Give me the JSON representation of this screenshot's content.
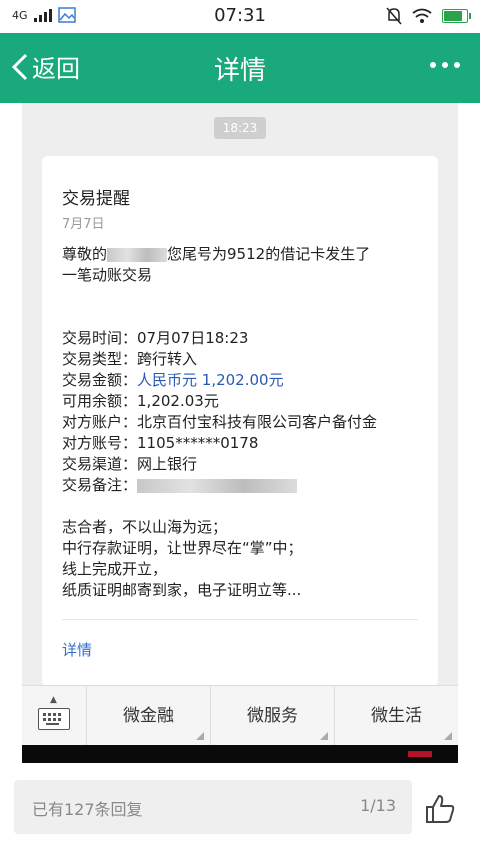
{
  "status_bar": {
    "network": "4G",
    "time": "07:31"
  },
  "nav": {
    "back_label": "返回",
    "title": "详情"
  },
  "chat": {
    "time_chip": "18:23",
    "card": {
      "title": "交易提醒",
      "date": "7月7日",
      "intro_prefix": "尊敬的",
      "intro_suffix": "您尾号为9512的借记卡发生了",
      "intro_line2": "一笔动账交易",
      "fields": [
        {
          "label": "交易时间：",
          "value": "07月07日18:23"
        },
        {
          "label": "交易类型：",
          "value": "跨行转入"
        },
        {
          "label": "交易金额：",
          "value": "人民币元 1,202.00元"
        },
        {
          "label": "可用余额：",
          "value": "1,202.03元"
        },
        {
          "label": "对方账户：",
          "value": "北京百付宝科技有限公司客户备付金"
        },
        {
          "label": "对方账号：",
          "value": "1105******0178"
        },
        {
          "label": "交易渠道：",
          "value": "网上银行"
        },
        {
          "label": "交易备注：",
          "value": ""
        }
      ],
      "slogan": [
        "志合者，不以山海为远；",
        "中行存款证明，让世界尽在“掌”中；",
        "线上完成开立，",
        "纸质证明邮寄到家，电子证明立等..."
      ],
      "detail_link": "详情"
    }
  },
  "bottom_menu": {
    "items": [
      "微金融",
      "微服务",
      "微生活"
    ]
  },
  "reply_bar": {
    "placeholder": "已有127条回复",
    "page": "1/13"
  },
  "colors": {
    "nav_bg": "#1aa97a",
    "link": "#2f6fd0",
    "amount": "#2b59b6"
  }
}
